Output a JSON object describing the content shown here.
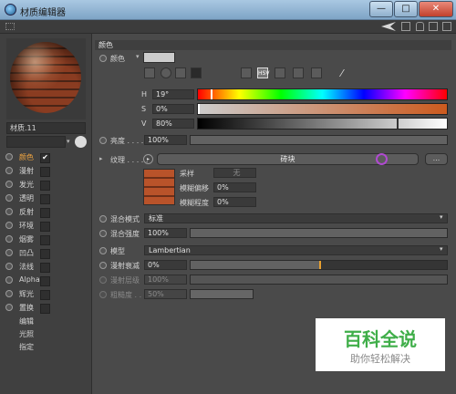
{
  "window": {
    "title": "材质编辑器",
    "close_glyph": "✕",
    "minimize_glyph": "—",
    "maximize_glyph": "□"
  },
  "preview": {
    "material_name": "材质.11"
  },
  "channels": [
    {
      "label": "颜色",
      "checked": true,
      "active": true,
      "check_mark": "✔"
    },
    {
      "label": "漫射",
      "checked": false
    },
    {
      "label": "发光",
      "checked": false
    },
    {
      "label": "透明",
      "checked": false
    },
    {
      "label": "反射",
      "checked": false
    },
    {
      "label": "环境",
      "checked": false
    },
    {
      "label": "烟雾",
      "checked": false
    },
    {
      "label": "凹凸",
      "checked": false
    },
    {
      "label": "法线",
      "checked": false
    },
    {
      "label": "Alpha",
      "checked": false
    },
    {
      "label": "辉光",
      "checked": false
    },
    {
      "label": "置换",
      "checked": false
    }
  ],
  "extra_items": [
    "编辑",
    "光照",
    "指定"
  ],
  "color_section": {
    "header": "颜色",
    "color_label": "颜色",
    "h_label": "H",
    "h_value": "19°",
    "s_label": "S",
    "s_value": "0%",
    "v_label": "V",
    "v_value": "80%",
    "h_level": 0.053,
    "s_level": 0.0,
    "v_level": 0.8,
    "swatch_color": "#cccccc"
  },
  "brightness": {
    "label": "亮度 . . . .",
    "value": "100%",
    "level": 1.0
  },
  "texture": {
    "label": "纹理 . . . . .",
    "name": "砖块",
    "more_button": "...",
    "sample_label": "采样",
    "sample_value": "无",
    "blur_offset_label": "模糊偏移",
    "blur_offset_value": "0%",
    "blur_amount_label": "模糊程度",
    "blur_amount_value": "0%"
  },
  "mix": {
    "mode_label": "混合模式",
    "mode_value": "标准",
    "strength_label": "混合强度",
    "strength_value": "100%",
    "strength_level": 1.0
  },
  "model": {
    "label": "模型",
    "value": "Lambertian",
    "diffuse_falloff_label": "漫射衰减",
    "diffuse_falloff_value": "0%",
    "diffuse_level_label": "漫射层级",
    "diffuse_level_value": "100%",
    "roughness_label": "粗糙度 . .",
    "roughness_value": "50%"
  },
  "watermark": {
    "title": "百科全说",
    "subtitle": "助你轻松解决"
  }
}
